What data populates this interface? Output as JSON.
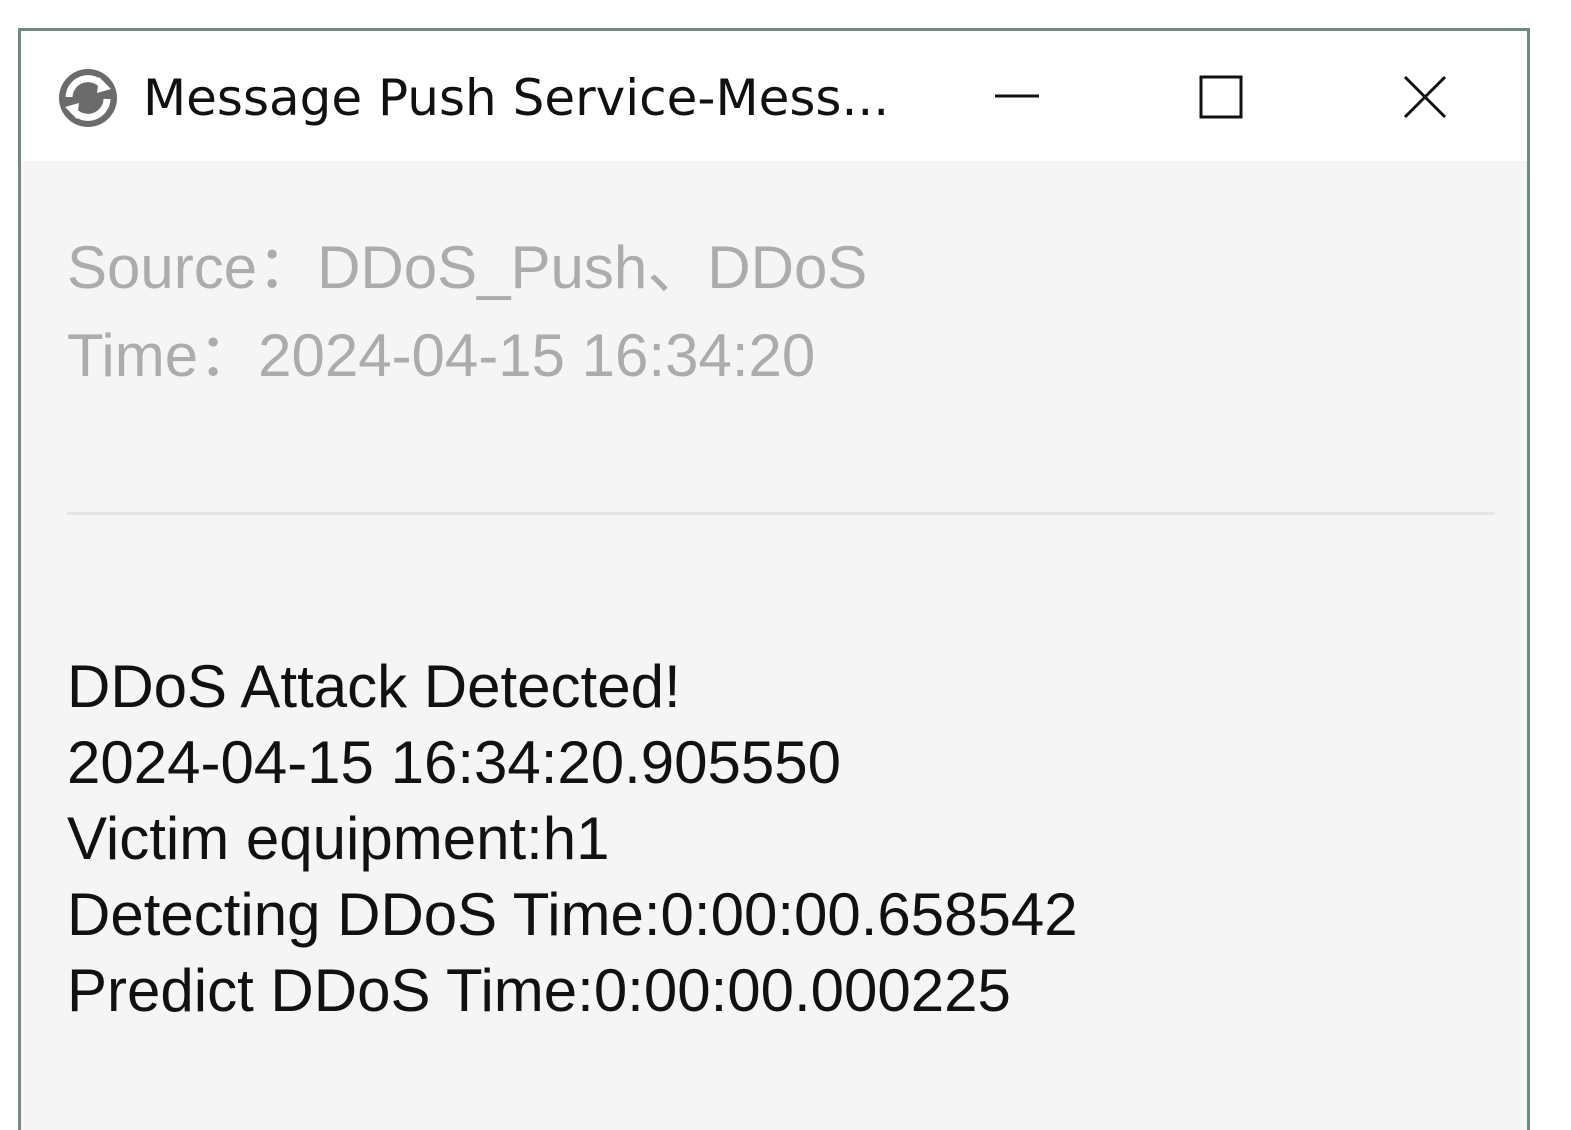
{
  "window": {
    "title": "Message Push Service-Mess...",
    "icon": "refresh-sync-icon",
    "controls": {
      "minimize_icon": "minimize-icon",
      "maximize_icon": "maximize-icon",
      "close_icon": "close-icon"
    },
    "border_color": "#6e8a82"
  },
  "meta": {
    "source": "Source：DDoS_Push、DDoS",
    "time": "Time：2024-04-15 16:34:20"
  },
  "message": {
    "lines": [
      "DDoS Attack Detected!",
      "2024-04-15 16:34:20.905550",
      "Victim equipment:h1",
      "Detecting DDoS Time:0:00:00.658542",
      "Predict DDoS Time:0:00:00.000225"
    ]
  }
}
